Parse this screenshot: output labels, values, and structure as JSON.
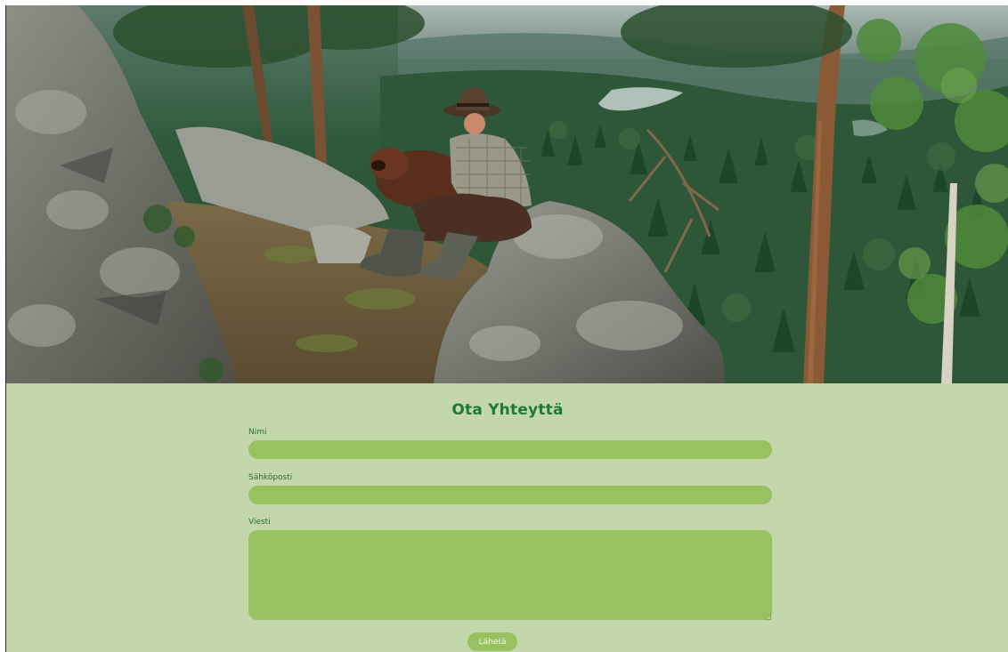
{
  "hero": {
    "image_icon": "forest-lookout-photo"
  },
  "contact_form": {
    "title": "Ota Yhteyttä",
    "name_label": "Nimi",
    "name_value": "",
    "email_label": "Sähköposti",
    "email_value": "",
    "message_label": "Viesti",
    "message_value": "",
    "submit_label": "Lähetä"
  },
  "colors": {
    "background": "#c4d7ab",
    "field": "#98c25f",
    "title": "#1f7a3a",
    "label": "#2e6b3b",
    "button_text": "#f4f8ec"
  }
}
